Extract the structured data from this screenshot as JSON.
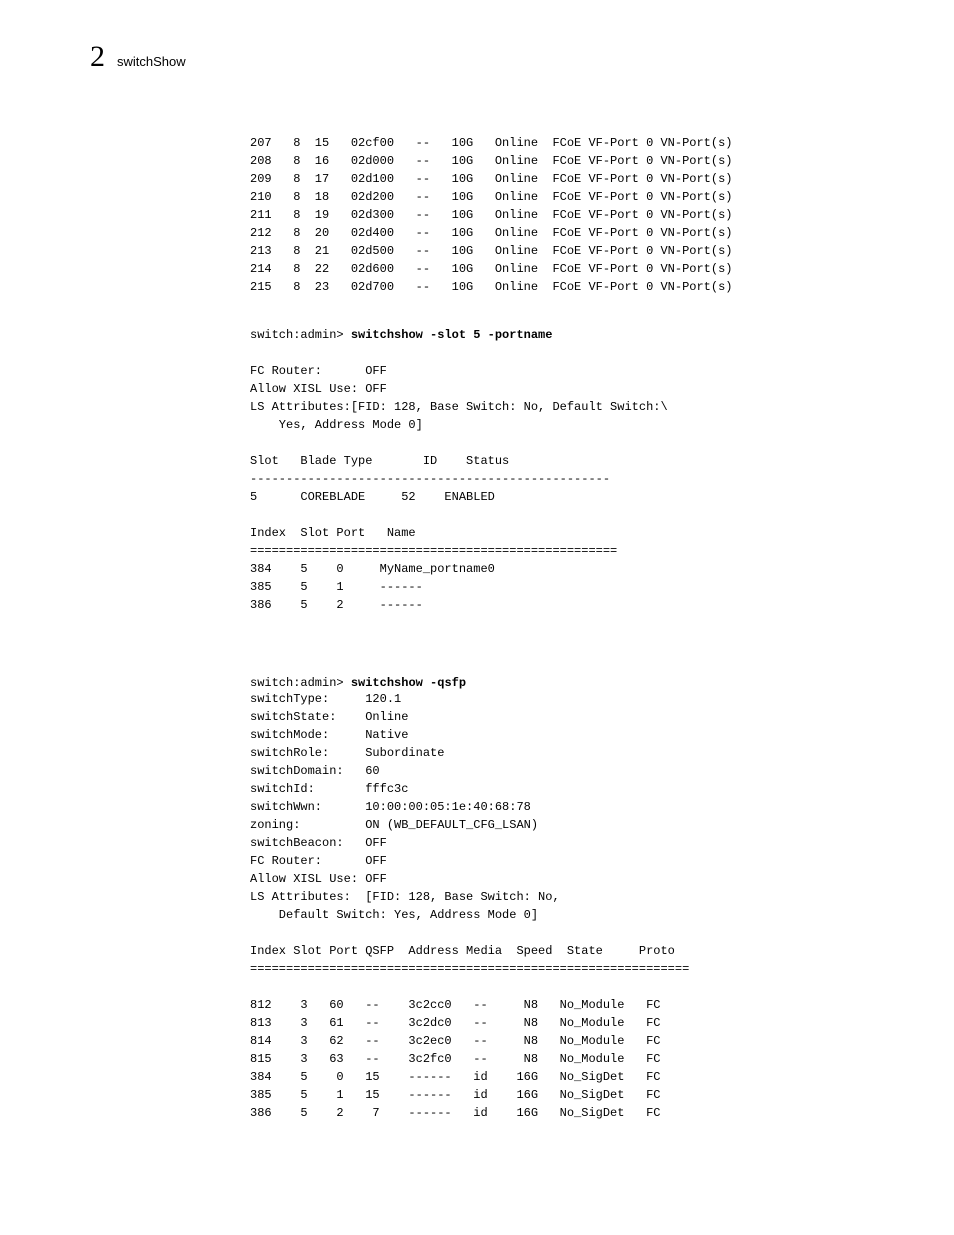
{
  "header": {
    "chapter": "2",
    "title": "switchShow"
  },
  "table1": "207   8  15   02cf00   --   10G   Online  FCoE VF-Port 0 VN-Port(s)\n208   8  16   02d000   --   10G   Online  FCoE VF-Port 0 VN-Port(s)\n209   8  17   02d100   --   10G   Online  FCoE VF-Port 0 VN-Port(s)\n210   8  18   02d200   --   10G   Online  FCoE VF-Port 0 VN-Port(s)\n211   8  19   02d300   --   10G   Online  FCoE VF-Port 0 VN-Port(s)\n212   8  20   02d400   --   10G   Online  FCoE VF-Port 0 VN-Port(s)\n213   8  21   02d500   --   10G   Online  FCoE VF-Port 0 VN-Port(s)\n214   8  22   02d600   --   10G   Online  FCoE VF-Port 0 VN-Port(s)\n215   8  23   02d700   --   10G   Online  FCoE VF-Port 0 VN-Port(s)",
  "cmd1": {
    "prompt": "switch:admin> ",
    "command": "switchshow -slot 5 -portname"
  },
  "output1": "FC Router:      OFF\nAllow XISL Use: OFF\nLS Attributes:[FID: 128, Base Switch: No, Default Switch:\\\n    Yes, Address Mode 0]\n\nSlot   Blade Type       ID    Status\n--------------------------------------------------\n5      COREBLADE     52    ENABLED\n\nIndex  Slot Port   Name\n===================================================\n384    5    0     MyName_portname0\n385    5    1     ------\n386    5    2     ------",
  "cmd2": {
    "prompt": "switch:admin> ",
    "command": "switchshow -qsfp"
  },
  "output2": "switchType:     120.1\nswitchState:    Online\nswitchMode:     Native\nswitchRole:     Subordinate\nswitchDomain:   60\nswitchId:       fffc3c\nswitchWwn:      10:00:00:05:1e:40:68:78\nzoning:         ON (WB_DEFAULT_CFG_LSAN)\nswitchBeacon:   OFF\nFC Router:      OFF\nAllow XISL Use: OFF\nLS Attributes:  [FID: 128, Base Switch: No,\n    Default Switch: Yes, Address Mode 0]\n\nIndex Slot Port QSFP  Address Media  Speed  State     Proto\n=============================================================\n\n812    3   60   --    3c2cc0   --     N8   No_Module   FC\n813    3   61   --    3c2dc0   --     N8   No_Module   FC\n814    3   62   --    3c2ec0   --     N8   No_Module   FC\n815    3   63   --    3c2fc0   --     N8   No_Module   FC\n384    5    0   15    ------   id    16G   No_SigDet   FC\n385    5    1   15    ------   id    16G   No_SigDet   FC\n386    5    2    7    ------   id    16G   No_SigDet   FC"
}
